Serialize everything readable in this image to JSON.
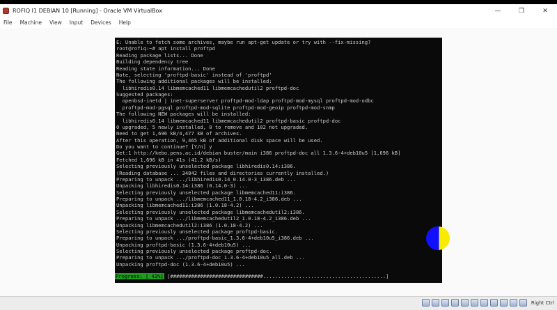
{
  "window": {
    "title": "ROFIQ I1 DEBIAN 10 [Running] - Oracle VM VirtualBox",
    "controls": [
      "—",
      "❐",
      "✕"
    ]
  },
  "menu": [
    "File",
    "Machine",
    "View",
    "Input",
    "Devices",
    "Help"
  ],
  "terminal": {
    "lines": [
      "E: Unable to fetch some archives, maybe run apt-get update or try with --fix-missing?",
      "root@rofiq:~# apt install proftpd",
      "Reading package lists... Done",
      "Building dependency tree",
      "Reading state information... Done",
      "Note, selecting 'proftpd-basic' instead of 'proftpd'",
      "The following additional packages will be installed:",
      "  libhiredis0.14 libmemcached11 libmemcachedutil2 proftpd-doc",
      "Suggested packages:",
      "  openbsd-inetd | inet-superserver proftpd-mod-ldap proftpd-mod-mysql proftpd-mod-odbc",
      "  proftpd-mod-pgsql proftpd-mod-sqlite proftpd-mod-geoip proftpd-mod-snmp",
      "The following NEW packages will be installed:",
      "  libhiredis0.14 libmemcached11 libmemcachedutil2 proftpd-basic proftpd-doc",
      "0 upgraded, 5 newly installed, 0 to remove and 102 not upgraded.",
      "Need to get 1,696 kB/4,477 kB of archives.",
      "After this operation, 9,465 kB of additional disk space will be used.",
      "Do you want to continue? [Y/n] y",
      "Get:1 http://kebo.pens.ac.id/debian buster/main i386 proftpd-doc all 1.3.6-4+deb10u5 [1,696 kB]",
      "Fetched 1,696 kB in 41s (41.2 kB/s)",
      "Selecting previously unselected package libhiredis0.14:i386.",
      "(Reading database ... 34842 files and directories currently installed.)",
      "Preparing to unpack .../libhiredis0.14_0.14.0-3_i386.deb ...",
      "Unpacking libhiredis0.14:i386 (0.14.0-3) ...",
      "Selecting previously unselected package libmemcached11:i386.",
      "Preparing to unpack .../libmemcached11_1.0.18-4.2_i386.deb ...",
      "Unpacking libmemcached11:i386 (1.0.18-4.2) ...",
      "Selecting previously unselected package libmemcachedutil2:i386.",
      "Preparing to unpack .../libmemcachedutil2_1.0.18-4.2_i386.deb ...",
      "Unpacking libmemcachedutil2:i386 (1.0.18-4.2) ...",
      "Selecting previously unselected package proftpd-basic.",
      "Preparing to unpack .../proftpd-basic_1.3.6-4+deb10u5_i386.deb ...",
      "Unpacking proftpd-basic (1.3.6-4+deb10u5) ...",
      "Selecting previously unselected package proftpd-doc.",
      "Preparing to unpack .../proftpd-doc_1.3.6-4+deb10u5_all.deb ...",
      "Unpacking proftpd-doc (1.3.6-4+deb10u5) ..."
    ],
    "progress_label": "Progress: [ 43%]",
    "progress_bar": "[###############################.........................................]",
    "progress_fraction": 0.43
  },
  "statusbar": {
    "host_key": "Right Ctrl"
  },
  "colors": {
    "terminal_bg": "#0a0a0a",
    "terminal_fg": "#c9c9c9",
    "progress_green": "#1f9d1f"
  }
}
